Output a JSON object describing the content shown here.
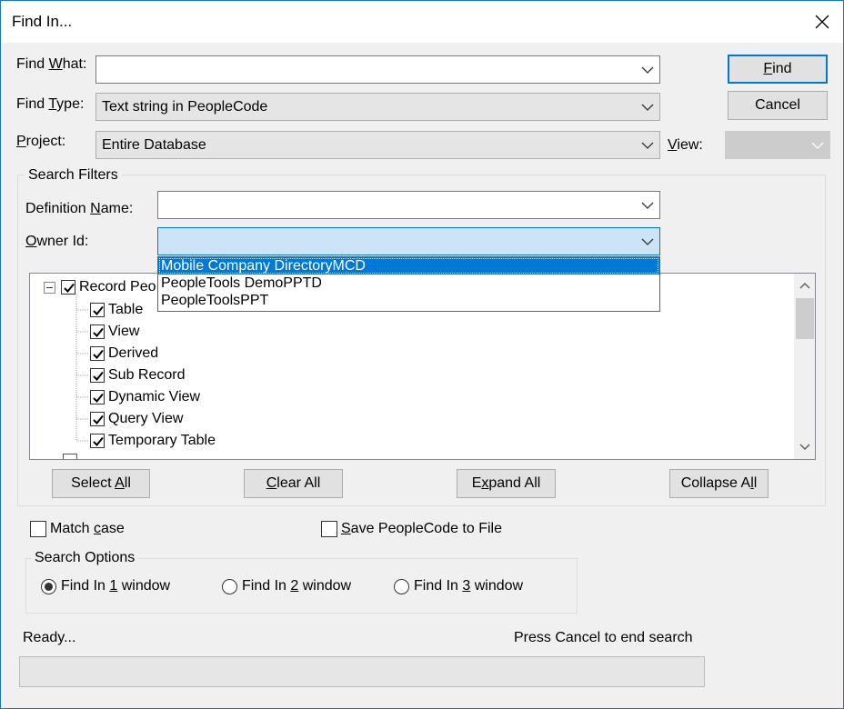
{
  "window": {
    "title": "Find In...",
    "close_icon": "close-icon"
  },
  "find_what": {
    "label_pre": "Find ",
    "label_u": "W",
    "label_post": "hat:",
    "value": ""
  },
  "find_type": {
    "label_pre": "Find ",
    "label_u": "T",
    "label_post": "ype:",
    "value": "Text string in PeopleCode"
  },
  "project": {
    "label_u": "P",
    "label_post": "roject:",
    "value": "Entire Database"
  },
  "view": {
    "label_u": "V",
    "label_post": "iew:",
    "value": ""
  },
  "buttons": {
    "find_u": "F",
    "find_post": "ind",
    "cancel": "Cancel"
  },
  "search_filters": {
    "caption": "Search Filters",
    "definition_name": {
      "label_pre": "Definition ",
      "label_u": "N",
      "label_post": "ame:",
      "value": ""
    },
    "owner_id": {
      "label_u": "O",
      "label_post": "wner Id:",
      "value": ""
    },
    "owner_options": [
      "Mobile Company DirectoryMCD",
      "PeopleTools DemoPPTD",
      "PeopleToolsPPT"
    ],
    "owner_selected_index": 0
  },
  "tree": {
    "items": [
      {
        "label": "Record Peo",
        "checked": true,
        "level": 0,
        "expander": "minus"
      },
      {
        "label": "Table",
        "checked": true,
        "level": 1
      },
      {
        "label": "View",
        "checked": true,
        "level": 1
      },
      {
        "label": "Derived",
        "checked": true,
        "level": 1
      },
      {
        "label": "Sub Record",
        "checked": true,
        "level": 1
      },
      {
        "label": "Dynamic View",
        "checked": true,
        "level": 1
      },
      {
        "label": "Query View",
        "checked": true,
        "level": 1
      },
      {
        "label": "Temporary Table",
        "checked": true,
        "level": 1
      }
    ]
  },
  "tree_buttons": {
    "select_all_pre": "Select ",
    "select_all_u": "A",
    "select_all_post": "ll",
    "clear_all_u": "C",
    "clear_all_post": "lear All",
    "expand_all_pre": "E",
    "expand_all_u": "x",
    "expand_all_post": "pand All",
    "collapse_all_pre": "Collapse A",
    "collapse_all_u": "l",
    "collapse_all_post": "l"
  },
  "options": {
    "match_case_pre": "Match ",
    "match_case_u": "c",
    "match_case_post": "ase",
    "match_case_checked": false,
    "save_pc_u": "S",
    "save_pc_post": "ave PeopleCode to File",
    "save_pc_checked": false
  },
  "search_options": {
    "caption": "Search Options",
    "r1_pre": "Find In ",
    "r1_u": "1",
    "r1_post": " window",
    "r2_pre": "Find In ",
    "r2_u": "2",
    "r2_post": " window",
    "r3_pre": "Find In ",
    "r3_u": "3",
    "r3_post": " window",
    "selected": 1
  },
  "status": {
    "left": "Ready...",
    "right": "Press Cancel to end search",
    "progress": 0
  },
  "colors": {
    "accent": "#0078d7",
    "dialog_bg": "#f0f0f0"
  }
}
